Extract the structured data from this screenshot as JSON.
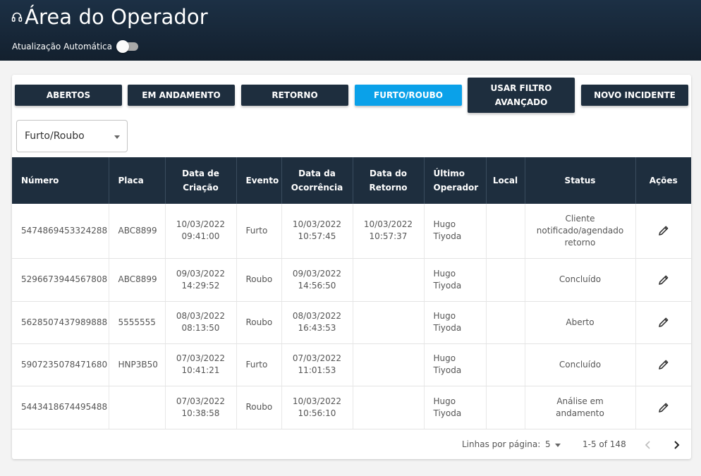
{
  "header": {
    "title": "Área do Operador",
    "auto_update_label": "Atualização Automática",
    "auto_update_on": false
  },
  "filters": {
    "buttons": [
      {
        "label": "ABERTOS",
        "active": false
      },
      {
        "label": "EM ANDAMENTO",
        "active": false
      },
      {
        "label": "RETORNO",
        "active": false
      },
      {
        "label": "FURTO/ROUBO",
        "active": true
      },
      {
        "label": "USAR FILTRO AVANÇADO",
        "active": false
      },
      {
        "label": "NOVO INCIDENTE",
        "active": false
      }
    ],
    "select_value": "Furto/Roubo"
  },
  "table": {
    "headers": [
      "Número",
      "Placa",
      "Data de Criação",
      "Evento",
      "Data da Ocorrência",
      "Data do Retorno",
      "Último Operador",
      "Local",
      "Status",
      "Ações"
    ],
    "rows": [
      {
        "numero": "5474869453324288",
        "placa": "ABC8899",
        "criacao_data": "10/03/2022",
        "criacao_hora": "09:41:00",
        "evento": "Furto",
        "ocorrencia_data": "10/03/2022",
        "ocorrencia_hora": "10:57:45",
        "retorno_data": "10/03/2022",
        "retorno_hora": "10:57:37",
        "operador": "Hugo Tiyoda",
        "local": "",
        "status": "Cliente notificado/agendado retorno"
      },
      {
        "numero": "5296673944567808",
        "placa": "ABC8899",
        "criacao_data": "09/03/2022",
        "criacao_hora": "14:29:52",
        "evento": "Roubo",
        "ocorrencia_data": "09/03/2022",
        "ocorrencia_hora": "14:56:50",
        "retorno_data": "",
        "retorno_hora": "",
        "operador": "Hugo Tiyoda",
        "local": "",
        "status": "Concluído"
      },
      {
        "numero": "5628507437989888",
        "placa": "5555555",
        "criacao_data": "08/03/2022",
        "criacao_hora": "08:13:50",
        "evento": "Roubo",
        "ocorrencia_data": "08/03/2022",
        "ocorrencia_hora": "16:43:53",
        "retorno_data": "",
        "retorno_hora": "",
        "operador": "Hugo Tiyoda",
        "local": "",
        "status": "Aberto"
      },
      {
        "numero": "5907235078471680",
        "placa": "HNP3B50",
        "criacao_data": "07/03/2022",
        "criacao_hora": "10:41:21",
        "evento": "Furto",
        "ocorrencia_data": "07/03/2022",
        "ocorrencia_hora": "11:01:53",
        "retorno_data": "",
        "retorno_hora": "",
        "operador": "Hugo Tiyoda",
        "local": "",
        "status": "Concluído"
      },
      {
        "numero": "5443418674495488",
        "placa": "",
        "criacao_data": "07/03/2022",
        "criacao_hora": "10:38:58",
        "evento": "Roubo",
        "ocorrencia_data": "10/03/2022",
        "ocorrencia_hora": "10:56:10",
        "retorno_data": "",
        "retorno_hora": "",
        "operador": "Hugo Tiyoda",
        "local": "",
        "status": "Análise em andamento"
      }
    ]
  },
  "pagination": {
    "rows_per_page_label": "Linhas por página:",
    "rows_per_page": "5",
    "range": "1-5 of 148"
  },
  "colors": {
    "header_bg": "#1c3045",
    "button_bg": "#1e2e3e",
    "button_active": "#0aa1e9"
  },
  "icons": {
    "title": "headset-icon",
    "edit": "pencil-icon",
    "prev": "chevron-left-icon",
    "next": "chevron-right-icon"
  }
}
